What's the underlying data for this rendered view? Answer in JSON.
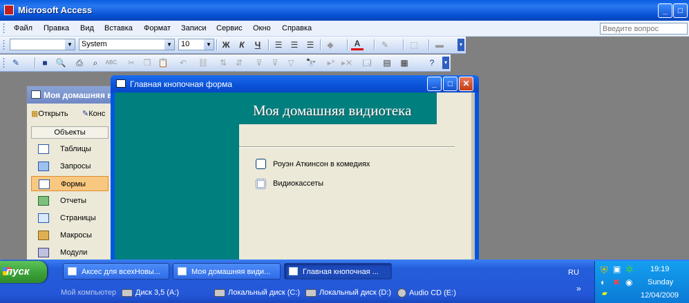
{
  "app": {
    "title": "Microsoft Access"
  },
  "menu": [
    "Файл",
    "Правка",
    "Вид",
    "Вставка",
    "Формат",
    "Записи",
    "Сервис",
    "Окно",
    "Справка"
  ],
  "help": {
    "placeholder": "Введите вопрос"
  },
  "formatting_toolbar": {
    "object_combo": "",
    "font_combo": "System",
    "size_combo": "10",
    "bold": "Ж",
    "italic": "К",
    "underline": "Ч",
    "font_color_letter": "A"
  },
  "db_window": {
    "title": "Моя домашняя в",
    "open_label": "Открыть",
    "design_label": "Конс",
    "objects_header": "Объекты",
    "items": [
      "Таблицы",
      "Запросы",
      "Формы",
      "Отчеты",
      "Страницы",
      "Макросы",
      "Модули"
    ],
    "selected": "Формы"
  },
  "switchboard": {
    "window_title": "Главная кнопочная форма",
    "form_title": "Моя домашняя видиотека",
    "buttons": [
      "Роуэн Аткинсон в комедиях",
      "Видиокассеты"
    ]
  },
  "taskbar": {
    "start_label": "пуск",
    "tasks": [
      "Аксес для всехНовы...",
      "Моя домашняя види...",
      "Главная кнопочная ..."
    ],
    "active_index": 2,
    "my_computer": "Мой компьютер",
    "drives": [
      "Диск 3,5 (A:)",
      "Локальный диск (C:)",
      "Локальный диск (D:)",
      "Audio CD (E:)"
    ],
    "language": "RU",
    "chevron": "»",
    "clock": {
      "time": "19:19",
      "day": "Sunday",
      "date": "12/04/2009"
    }
  },
  "colors": {
    "form_teal": "#007f7f",
    "xp_blue": "#0a5fe0",
    "start_green": "#3a9e37",
    "selected_item": "#f8c880"
  }
}
